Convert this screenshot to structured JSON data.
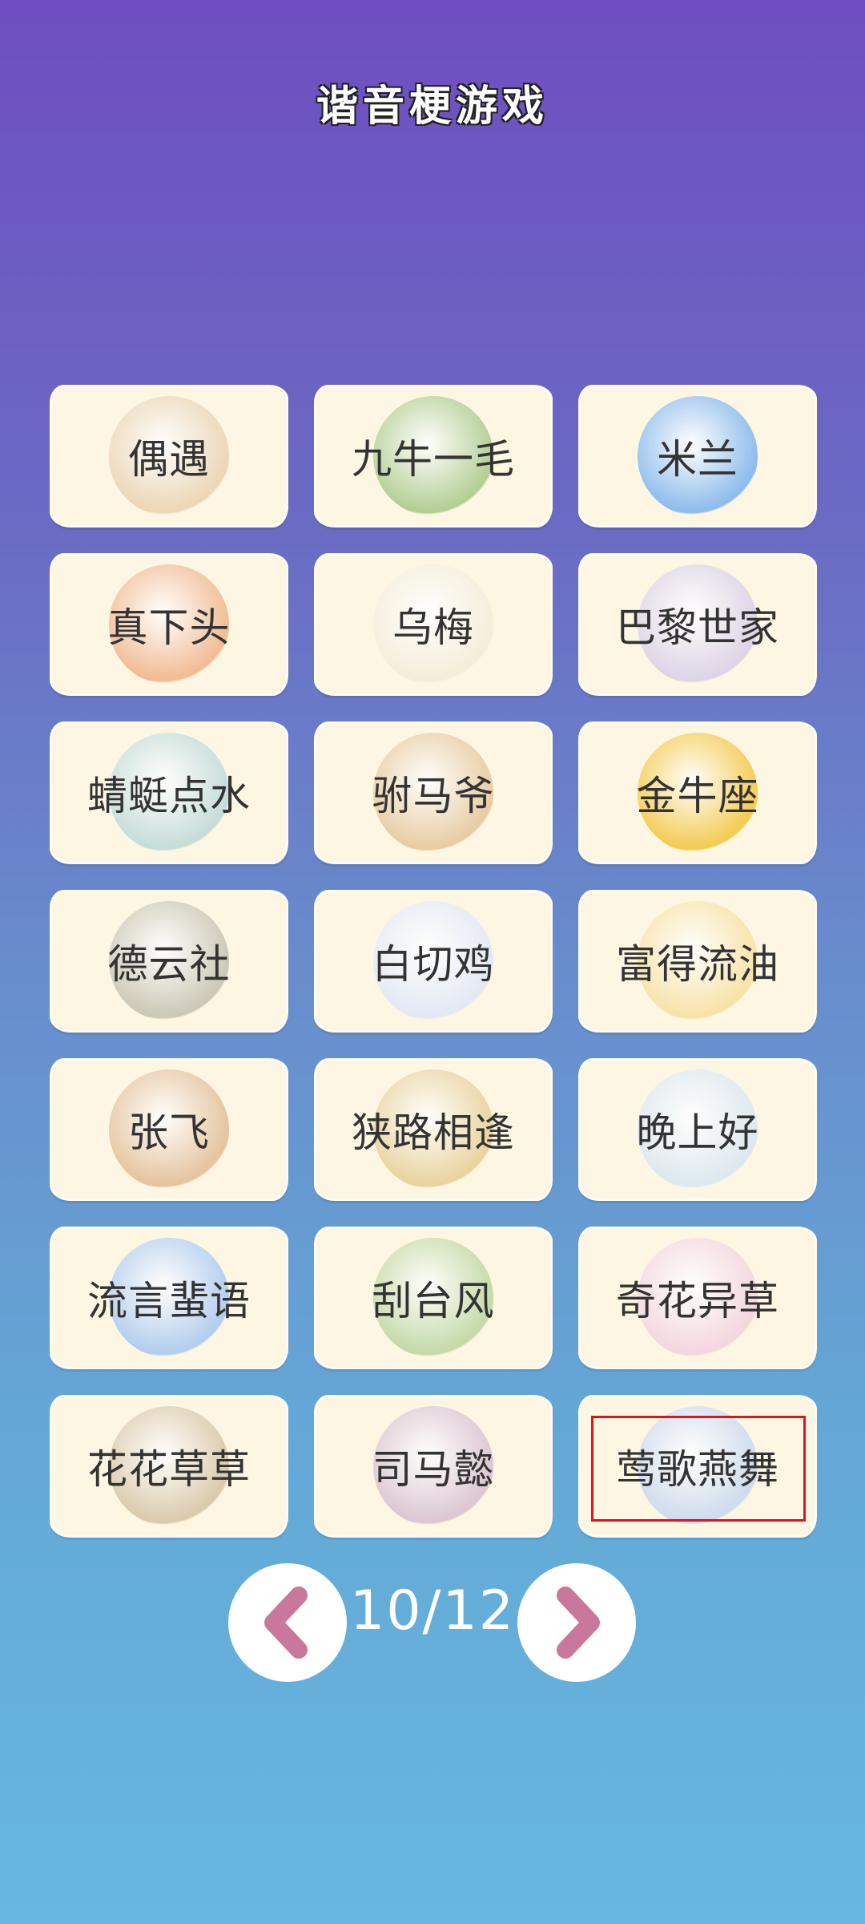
{
  "header": {
    "title": "谐音梗游戏"
  },
  "cards": [
    {
      "label": "偶遇",
      "icon": "lotus-root-fish-plate-icon",
      "art_color": "#e9d2b0"
    },
    {
      "label": "九牛一毛",
      "icon": "cows-under-tree-icon",
      "art_color": "#a9c98a"
    },
    {
      "label": "米兰",
      "icon": "blue-rice-grain-icon",
      "art_color": "#7fb4ee"
    },
    {
      "label": "真下头",
      "icon": "shrimp-steamer-icon",
      "art_color": "#f0b48a"
    },
    {
      "label": "乌梅",
      "icon": "dashed-outline-icon",
      "art_color": "#f3ecd8"
    },
    {
      "label": "巴黎世家",
      "icon": "paris-swallow-icon",
      "art_color": "#d9cfe6"
    },
    {
      "label": "蜻蜓点水",
      "icon": "dragonfly-cafe-icon",
      "art_color": "#bfd9d6"
    },
    {
      "label": "驸马爷",
      "icon": "horse-money-icon",
      "art_color": "#e4c79a"
    },
    {
      "label": "金牛座",
      "icon": "golden-bull-throne-icon",
      "art_color": "#f2c640"
    },
    {
      "label": "德云社",
      "icon": "archers-icon",
      "art_color": "#c6c2b0"
    },
    {
      "label": "白切鸡",
      "icon": "rabbit-airplane-icon",
      "art_color": "#dfe7f6"
    },
    {
      "label": "富得流油",
      "icon": "dripping-egg-icon",
      "art_color": "#f6e0a0"
    },
    {
      "label": "张飞",
      "icon": "flying-deer-icon",
      "art_color": "#e2bd95"
    },
    {
      "label": "狭路相逢",
      "icon": "deer-elephant-bee-icon",
      "art_color": "#e6cf96"
    },
    {
      "label": "晚上好",
      "icon": "oyster-bowl-icon",
      "art_color": "#d8e6f0"
    },
    {
      "label": "流言蜚语",
      "icon": "blue-fish-icon",
      "art_color": "#a9c8ef"
    },
    {
      "label": "刮台风",
      "icon": "watermelon-stall-icon",
      "art_color": "#bcd6a0"
    },
    {
      "label": "奇花异草",
      "icon": "flowers-icon",
      "art_color": "#f2d3dd"
    },
    {
      "label": "花花草草",
      "icon": "mona-lisa-painter-icon",
      "art_color": "#d6c4a4"
    },
    {
      "label": "司马懿",
      "icon": "ants-icon",
      "art_color": "#d7c0cf"
    },
    {
      "label": "莺歌燕舞",
      "icon": "parrot-swallow-icon",
      "art_color": "#c8d8ee",
      "selected": true
    }
  ],
  "pager": {
    "page_indicator": "10/12",
    "prev_icon": "chevron-left-icon",
    "next_icon": "chevron-right-icon",
    "chevron_color": "#c9789c"
  }
}
